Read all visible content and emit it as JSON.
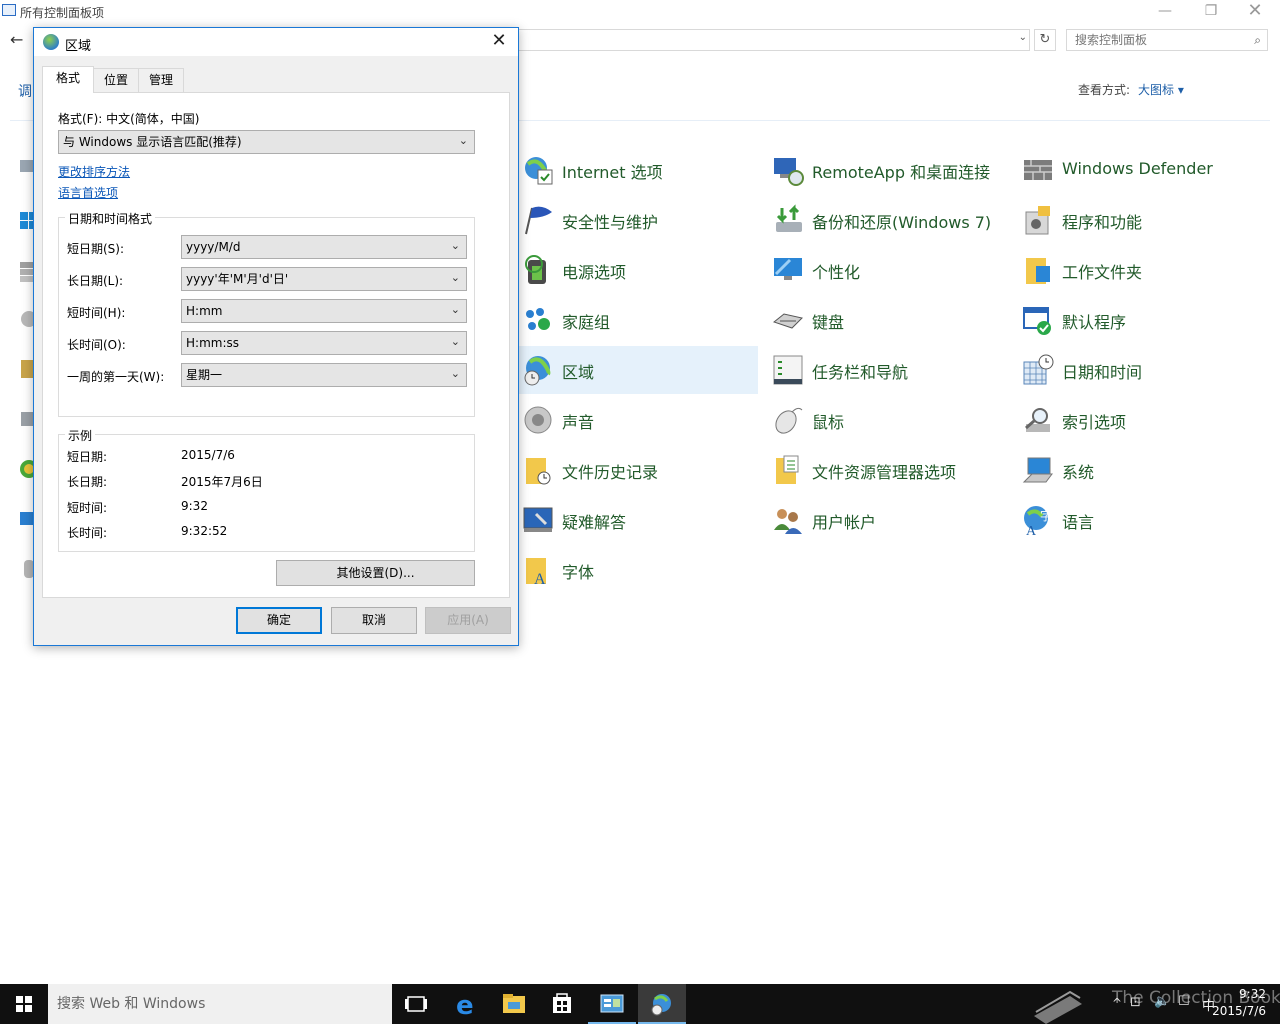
{
  "cp": {
    "title": "所有控制面板项",
    "heading": "调",
    "search_placeholder": "搜索控制面板",
    "view_by_label": "查看方式:",
    "view_by_value": "大图标 ▾",
    "items": [
      {
        "label": "Internet 选项",
        "icon": "internet-options-icon"
      },
      {
        "label": "RemoteApp 和桌面连接",
        "icon": "remoteapp-icon"
      },
      {
        "label": "Windows Defender",
        "icon": "defender-icon"
      },
      {
        "label": "安全性与维护",
        "icon": "security-flag-icon"
      },
      {
        "label": "备份和还原(Windows 7)",
        "icon": "backup-icon"
      },
      {
        "label": "程序和功能",
        "icon": "programs-icon"
      },
      {
        "label": "电源选项",
        "icon": "power-icon"
      },
      {
        "label": "个性化",
        "icon": "personalization-icon"
      },
      {
        "label": "工作文件夹",
        "icon": "work-folders-icon"
      },
      {
        "label": "家庭组",
        "icon": "homegroup-icon"
      },
      {
        "label": "键盘",
        "icon": "keyboard-icon"
      },
      {
        "label": "默认程序",
        "icon": "default-programs-icon"
      },
      {
        "label": "区域",
        "icon": "region-icon"
      },
      {
        "label": "任务栏和导航",
        "icon": "taskbar-icon"
      },
      {
        "label": "日期和时间",
        "icon": "date-time-icon"
      },
      {
        "label": "声音",
        "icon": "sound-icon"
      },
      {
        "label": "鼠标",
        "icon": "mouse-icon"
      },
      {
        "label": "索引选项",
        "icon": "indexing-icon"
      },
      {
        "label": "文件历史记录",
        "icon": "file-history-icon"
      },
      {
        "label": "文件资源管理器选项",
        "icon": "explorer-options-icon"
      },
      {
        "label": "系统",
        "icon": "system-icon"
      },
      {
        "label": "疑难解答",
        "icon": "troubleshoot-icon"
      },
      {
        "label": "用户帐户",
        "icon": "user-accounts-icon"
      },
      {
        "label": "语言",
        "icon": "language-icon"
      },
      {
        "label": "字体",
        "icon": "fonts-icon"
      }
    ]
  },
  "dialog": {
    "title": "区域",
    "tabs": [
      "格式",
      "位置",
      "管理"
    ],
    "format_label": "格式(F): 中文(简体，中国)",
    "format_value": "与 Windows 显示语言匹配(推荐)",
    "link_sort": "更改排序方法",
    "link_lang": "语言首选项",
    "group_datetime": "日期和时间格式",
    "rows": [
      {
        "label": "短日期(S):",
        "value": "yyyy/M/d"
      },
      {
        "label": "长日期(L):",
        "value": "yyyy'年'M'月'd'日'"
      },
      {
        "label": "短时间(H):",
        "value": "H:mm"
      },
      {
        "label": "长时间(O):",
        "value": "H:mm:ss"
      },
      {
        "label": "一周的第一天(W):",
        "value": "星期一"
      }
    ],
    "group_example": "示例",
    "examples": [
      {
        "label": "短日期:",
        "value": "2015/7/6"
      },
      {
        "label": "长日期:",
        "value": "2015年7月6日"
      },
      {
        "label": "短时间:",
        "value": "9:32"
      },
      {
        "label": "长时间:",
        "value": "9:32:52"
      }
    ],
    "other_settings": "其他设置(D)...",
    "ok": "确定",
    "cancel": "取消",
    "apply": "应用(A)"
  },
  "taskbar": {
    "search": "搜索 Web 和 Windows",
    "time": "9:32",
    "date": "2015/7/6",
    "ime": "中",
    "watermark": "The Collection Book"
  },
  "colors": {
    "accent": "#0078d7",
    "link": "#0b57b8",
    "cp_label": "#215a2a",
    "selection": "#e5f1fb",
    "taskbar": "#101010"
  }
}
